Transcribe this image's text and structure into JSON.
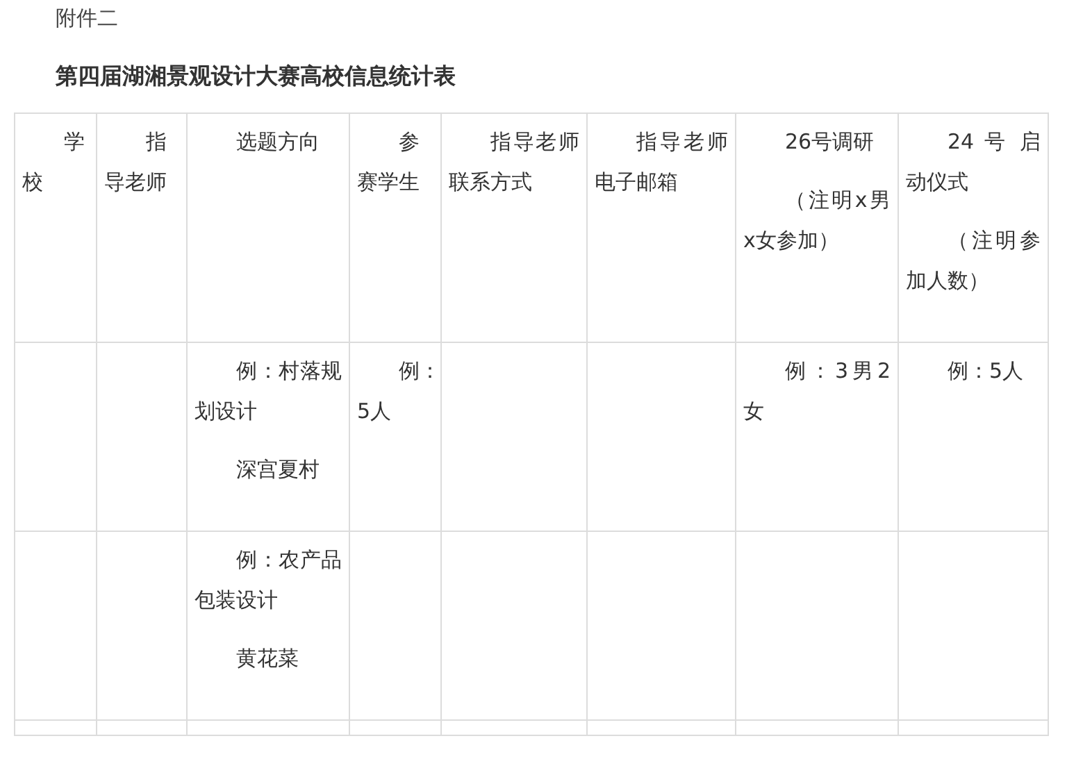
{
  "attachment_label": "附件二",
  "title": "第四届湖湘景观设计大赛高校信息统计表",
  "table": {
    "rows": [
      {
        "cells": [
          {
            "paragraphs": [
              "学校"
            ]
          },
          {
            "paragraphs": [
              "指导老师"
            ]
          },
          {
            "paragraphs": [
              "选题方向"
            ]
          },
          {
            "paragraphs": [
              "参赛学生"
            ]
          },
          {
            "paragraphs": [
              "指导老师联系方式"
            ]
          },
          {
            "paragraphs": [
              "指导老师电子邮箱"
            ]
          },
          {
            "paragraphs": [
              "26号调研",
              "（注明x男x女参加）"
            ]
          },
          {
            "paragraphs": [
              "24 号 启动仪式",
              "（注明参加人数）"
            ]
          }
        ]
      },
      {
        "cells": [
          {
            "kind": "blank"
          },
          {
            "kind": "blank"
          },
          {
            "paragraphs": [
              "例：村落规划设计",
              "深宫夏村"
            ]
          },
          {
            "paragraphs": [
              "例：5人"
            ]
          },
          {
            "kind": "blank"
          },
          {
            "kind": "blank"
          },
          {
            "paragraphs": [
              "例：3男2女"
            ]
          },
          {
            "paragraphs": [
              "例：5人"
            ]
          }
        ]
      },
      {
        "cells": [
          {
            "kind": "blank"
          },
          {
            "kind": "blank"
          },
          {
            "paragraphs": [
              "例：农产品包装设计",
              "黄花菜"
            ]
          },
          {
            "kind": "blank"
          },
          {
            "kind": "blank"
          },
          {
            "kind": "blank"
          },
          {
            "kind": "blank"
          },
          {
            "kind": "blank"
          }
        ]
      },
      {
        "cells": [
          {
            "kind": "blank"
          },
          {
            "kind": "blank"
          },
          {
            "kind": "blank"
          },
          {
            "kind": "blank"
          },
          {
            "kind": "blank"
          },
          {
            "kind": "blank"
          },
          {
            "kind": "blank"
          },
          {
            "kind": "blank"
          }
        ]
      }
    ]
  }
}
